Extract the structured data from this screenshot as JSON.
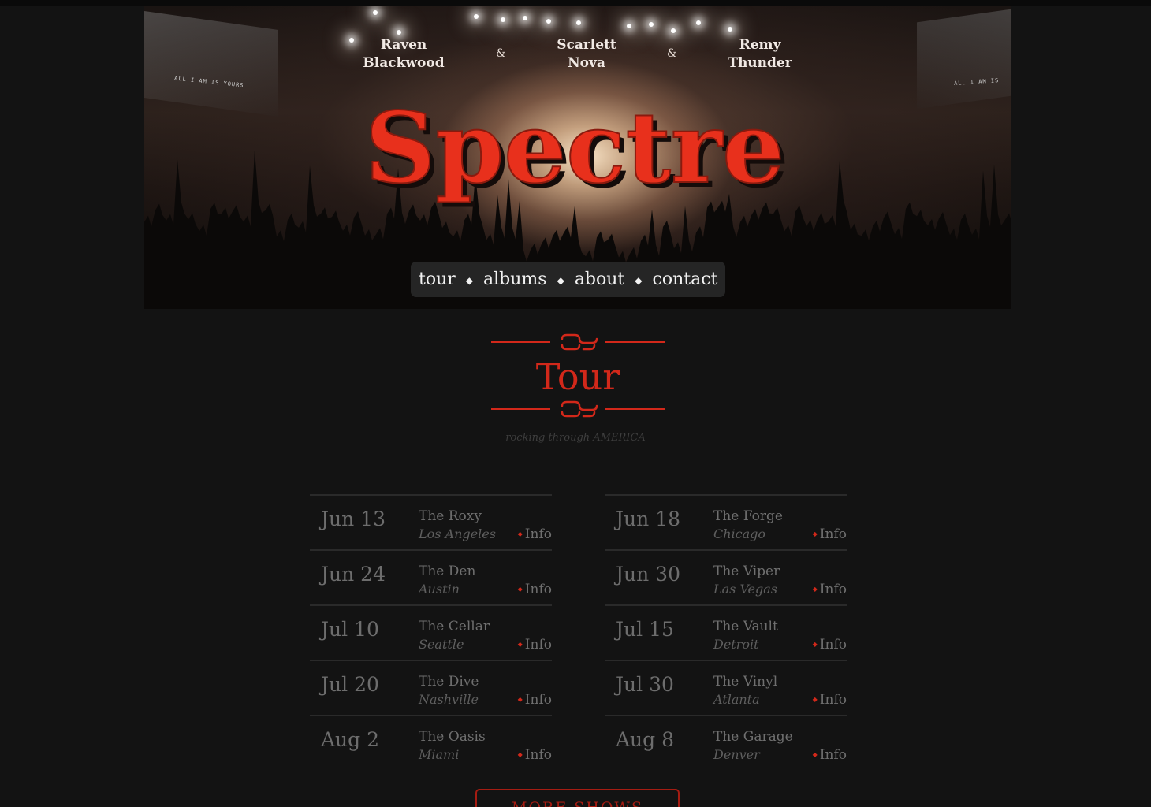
{
  "hero": {
    "members": [
      "Raven Blackwood",
      "Scarlett Nova",
      "Remy Thunder"
    ],
    "member_lines": [
      [
        "Raven",
        "Blackwood"
      ],
      [
        "Scarlett",
        "Nova"
      ],
      [
        "Remy",
        "Thunder"
      ]
    ],
    "ampersand": "&",
    "band_name": "Spectre",
    "screen_text": "ALL I AM IS YOURS",
    "screen_text_right": "ALL I AM IS"
  },
  "nav": {
    "items": [
      "tour",
      "albums",
      "about",
      "contact"
    ],
    "separator": "◆"
  },
  "section": {
    "title": "Tour",
    "subtitle": "rocking through AMERICA"
  },
  "shows": [
    {
      "date": "Jun 13",
      "venue": "The Roxy",
      "city": "Los Angeles",
      "info": "Info"
    },
    {
      "date": "Jun 18",
      "venue": "The Forge",
      "city": "Chicago",
      "info": "Info"
    },
    {
      "date": "Jun 24",
      "venue": "The Den",
      "city": "Austin",
      "info": "Info"
    },
    {
      "date": "Jun 30",
      "venue": "The Viper",
      "city": "Las Vegas",
      "info": "Info"
    },
    {
      "date": "Jul 10",
      "venue": "The Cellar",
      "city": "Seattle",
      "info": "Info"
    },
    {
      "date": "Jul 15",
      "venue": "The Vault",
      "city": "Detroit",
      "info": "Info"
    },
    {
      "date": "Jul 20",
      "venue": "The Dive",
      "city": "Nashville",
      "info": "Info"
    },
    {
      "date": "Jul 30",
      "venue": "The Vinyl",
      "city": "Atlanta",
      "info": "Info"
    },
    {
      "date": "Aug 2",
      "venue": "The Oasis",
      "city": "Miami",
      "info": "Info"
    },
    {
      "date": "Aug 8",
      "venue": "The Garage",
      "city": "Denver",
      "info": "Info"
    }
  ],
  "more_button": {
    "label": "MORE SHOWS"
  },
  "colors": {
    "accent": "#d2281a",
    "logo_red": "#e8301c",
    "background": "#131313",
    "text_muted": "#6f6f6f",
    "nav_bg": "#282828"
  }
}
